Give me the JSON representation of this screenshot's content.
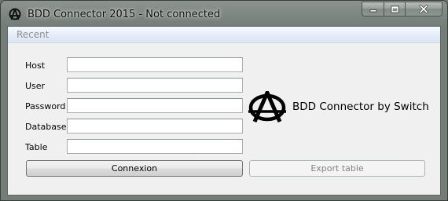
{
  "window": {
    "title": "BDD Connector 2015 - Not connected"
  },
  "menu": {
    "recent_label": "Recent"
  },
  "form": {
    "host_label": "Host",
    "host_value": "",
    "user_label": "User",
    "user_value": "",
    "password_label": "Password",
    "password_value": "",
    "database_label": "Database",
    "database_value": "",
    "table_label": "Table",
    "table_value": ""
  },
  "branding": {
    "text": "BDD Connector by Switch",
    "logo_icon": "anarchy-logo-icon"
  },
  "buttons": {
    "connect_label": "Connexion",
    "export_label": "Export table",
    "export_enabled": false
  },
  "icons": {
    "app": "anarchy-icon",
    "minimize": "minimize-icon",
    "maximize": "maximize-icon",
    "close": "close-icon"
  }
}
